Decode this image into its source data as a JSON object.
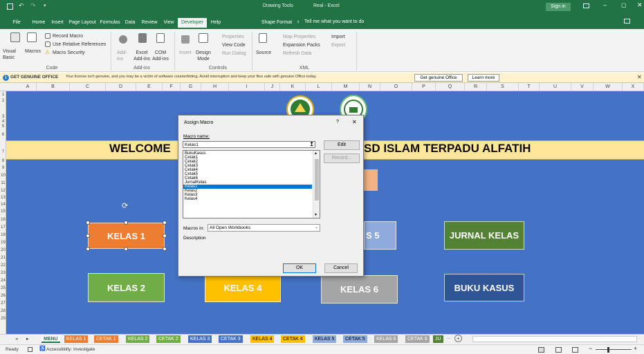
{
  "title_bar": {
    "context_tab": "Drawing Tools",
    "app_title": "Real - Excel",
    "sign_in": "Sign in"
  },
  "ribbon_tabs": [
    "File",
    "Home",
    "Insert",
    "Page Layout",
    "Formulas",
    "Data",
    "Review",
    "View",
    "Developer",
    "Help",
    "Shape Format"
  ],
  "tell_me": "Tell me what you want to do",
  "ribbon": {
    "code": {
      "visual_basic": "Visual Basic",
      "macros": "Macros",
      "record_macro": "Record Macro",
      "use_relative": "Use Relative References",
      "macro_security": "Macro Security",
      "group": "Code"
    },
    "addins": {
      "addins": "Add-ins",
      "excel_addins": "Excel Add-ins",
      "com_addins": "COM Add-ins",
      "group": "Add-ins"
    },
    "controls": {
      "insert": "Insert",
      "design_mode": "Design Mode",
      "properties": "Properties",
      "view_code": "View Code",
      "run_dialog": "Run Dialog",
      "group": "Controls"
    },
    "xml": {
      "source": "Source",
      "map_properties": "Map Properties",
      "expansion_packs": "Expansion Packs",
      "refresh_data": "Refresh Data",
      "import": "Import",
      "export": "Export",
      "group": "XML"
    }
  },
  "message_bar": {
    "label": "GET GENUINE OFFICE",
    "text": "Your license isn't genuine, and you may be a victim of software counterfeiting. Avoid interruption and keep your files safe with genuine Office today.",
    "btn1": "Get genuine Office",
    "btn2": "Learn more"
  },
  "columns": [
    "A",
    "B",
    "C",
    "D",
    "E",
    "F",
    "G",
    "H",
    "I",
    "J",
    "K",
    "L",
    "M",
    "N",
    "O",
    "P",
    "Q",
    "R",
    "S",
    "T",
    "U",
    "V",
    "W",
    "X"
  ],
  "rows": [
    "1",
    "2",
    "3",
    "4",
    "5",
    "6",
    "7",
    "8",
    "9",
    "10",
    "11",
    "12",
    "13",
    "14",
    "15",
    "16",
    "17",
    "18",
    "19",
    "20",
    "21",
    "22",
    "23",
    "24",
    "25",
    "26",
    "27",
    "28",
    "29"
  ],
  "sheet": {
    "banner_left": "WELCOME",
    "banner_right": "SD ISLAM TERPADU ALFATIH",
    "buttons": {
      "kelas1": "KELAS 1",
      "kelas2": "KELAS 2",
      "kelas4": "KELAS 4",
      "kelas5_partial": "S 5",
      "kelas6": "KELAS 6",
      "jurnal": "JURNAL KELAS",
      "buku": "BUKU KASUS"
    },
    "colors": {
      "blue": "#4472c4",
      "orange": "#ed7d31",
      "green": "#70ad47",
      "gold": "#ffc000",
      "grey": "#a5a5a5",
      "navy": "#2f5597",
      "banner": "#ffe699"
    }
  },
  "dialog": {
    "title": "Assign Macro",
    "help": "?",
    "close": "✕",
    "macro_name_label": "Macro name:",
    "macro_name_value": "Kelas1",
    "macros": [
      "BukuKasus",
      "Cetak1",
      "Cetak2",
      "Cetak3",
      "Cetak4",
      "Cetak5",
      "Cetak6",
      "JurnalKelas",
      "Kelas1",
      "Kelas2",
      "Kelas3",
      "Kelas4"
    ],
    "selected": "Kelas1",
    "edit": "Edit",
    "record": "Record...",
    "macros_in_label": "Macros in:",
    "macros_in_value": "All Open Workbooks",
    "description_label": "Description",
    "ok": "OK",
    "cancel": "Cancel"
  },
  "sheet_tabs": [
    "MENU",
    "KELAS 1",
    "CETAK 1",
    "KELAS 2",
    "CETAK 2",
    "KELAS 3",
    "CETAK 3",
    "KELAS 4",
    "CETAK 4",
    "KELAS 5",
    "CETAK 5",
    "KELAS 6",
    "CETAK 6",
    "JU"
  ],
  "status": {
    "ready": "Ready",
    "accessibility": "Accessibility: Investigate"
  }
}
